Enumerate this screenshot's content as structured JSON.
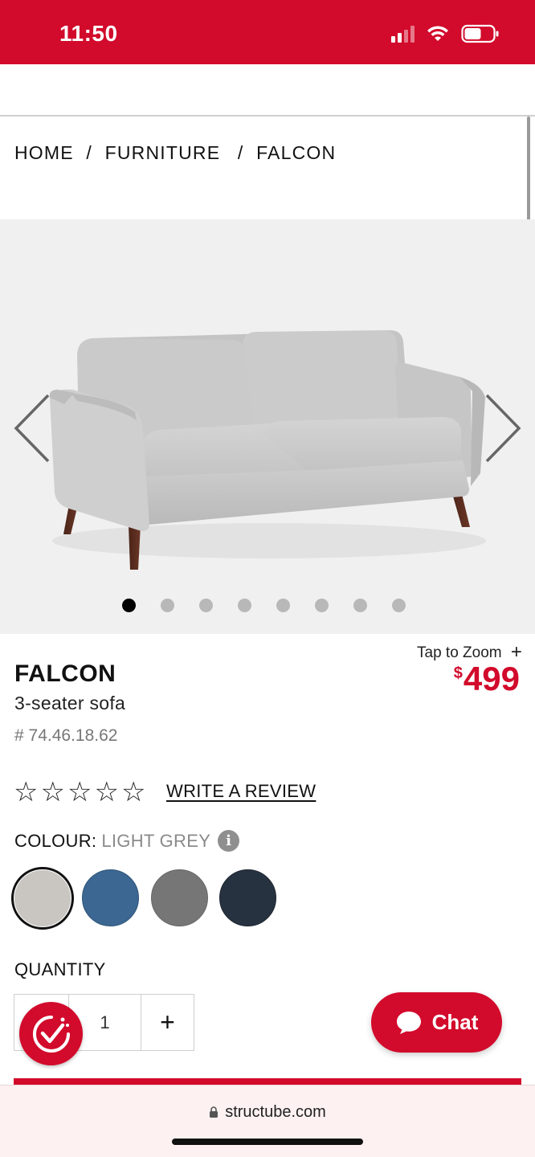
{
  "status_bar": {
    "time": "11:50",
    "icons": [
      "signal-icon",
      "wifi-icon",
      "battery-icon"
    ],
    "background": "#d20a2b"
  },
  "breadcrumb": {
    "items": [
      "HOME",
      "FURNITURE",
      "FALCON"
    ],
    "separator": "/"
  },
  "gallery": {
    "slide_count": 8,
    "active_index": 0,
    "prev_icon": "chevron-left-icon",
    "next_icon": "chevron-right-icon",
    "image_alt": "sofa-image"
  },
  "product": {
    "zoom_label": "Tap to Zoom",
    "zoom_icon": "plus-icon",
    "name": "FALCON",
    "subtitle": "3-seater sofa",
    "sku": "# 74.46.18.62",
    "price_currency": "$",
    "price_value": "499",
    "rating_stars": 5,
    "rating_value": 0,
    "review_link": "WRITE A REVIEW"
  },
  "colour": {
    "label": "COLOUR:",
    "selected": "LIGHT GREY",
    "info_icon": "i",
    "swatches": [
      {
        "name": "light-grey",
        "color": "#c9c6c2",
        "selected": true
      },
      {
        "name": "blue",
        "color": "#3c6793",
        "selected": false
      },
      {
        "name": "grey",
        "color": "#767676",
        "selected": false
      },
      {
        "name": "navy",
        "color": "#273241",
        "selected": false
      }
    ]
  },
  "quantity": {
    "label": "QUANTITY",
    "value": "1",
    "minus": "−",
    "plus": "+"
  },
  "chat": {
    "label": "Chat",
    "icon": "chat-bubble-icon"
  },
  "browser": {
    "domain": "structube.com",
    "lock_icon": "lock-icon"
  },
  "colors": {
    "brand_red": "#d20a2b",
    "gallery_bg": "#f0f0f0"
  }
}
